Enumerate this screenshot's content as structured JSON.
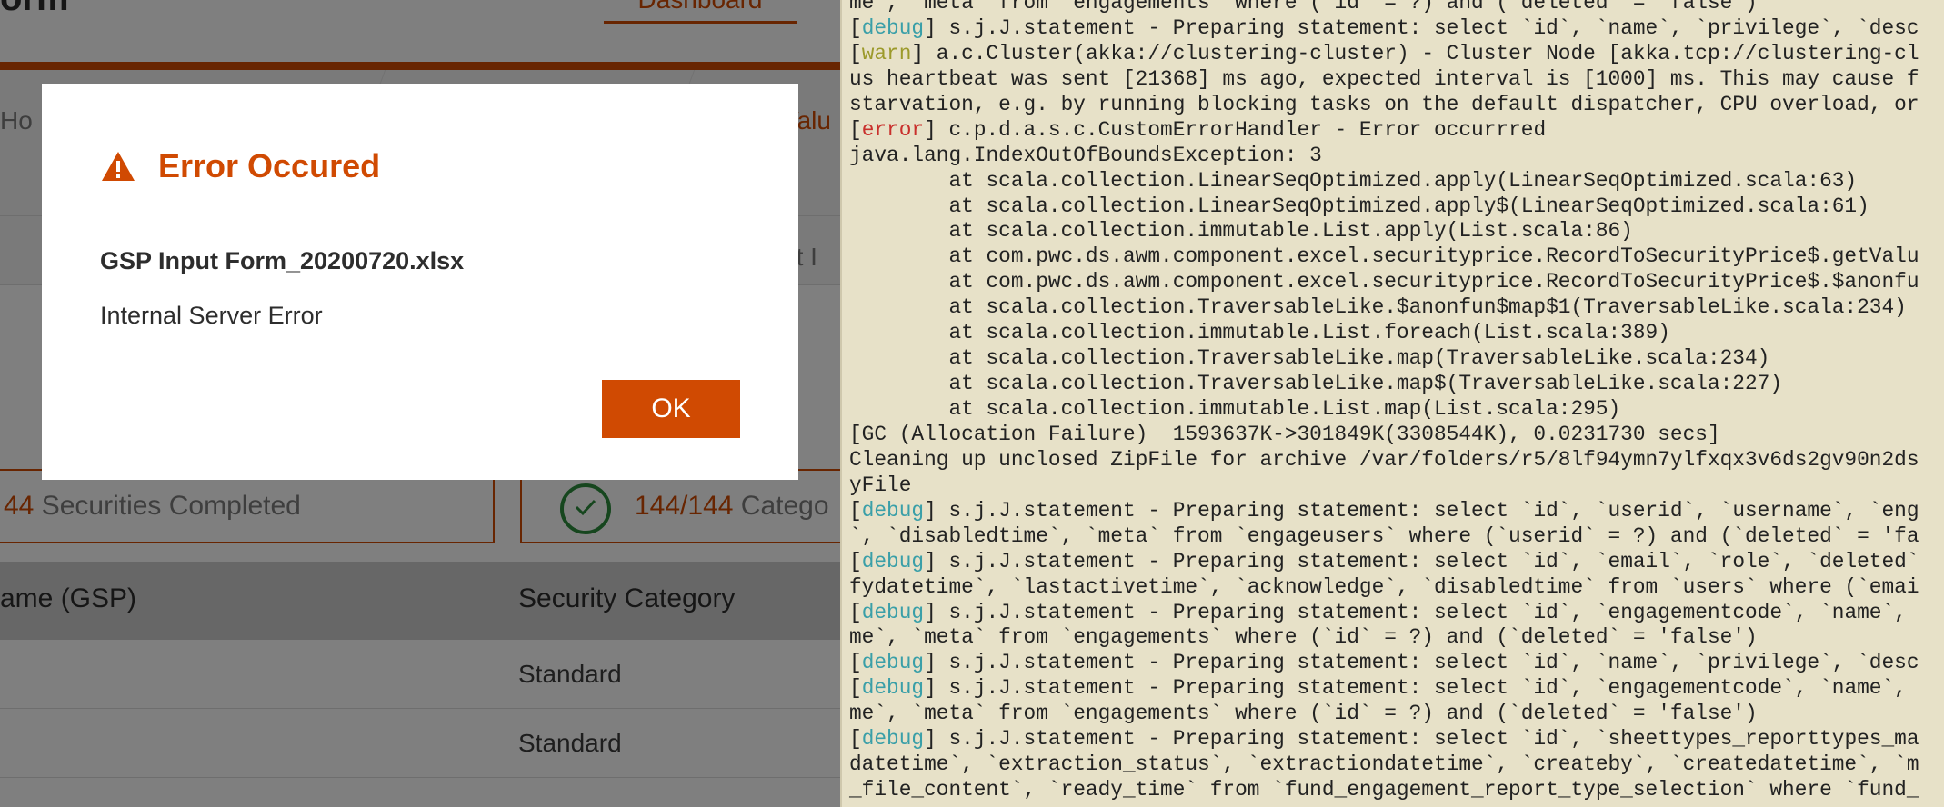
{
  "app": {
    "title": "orm",
    "nav_tab": "Dashboard",
    "steps": [
      "Ho",
      "Valu"
    ],
    "form_label": "ut I",
    "summary": {
      "securities_count": "44",
      "securities_text": " Securities Completed",
      "category_count": "144/144",
      "category_text": " Catego"
    },
    "table": {
      "headers": [
        "ame (GSP)",
        "Security Category"
      ],
      "rows": [
        {
          "category": "Standard"
        },
        {
          "category": "Standard"
        }
      ]
    }
  },
  "modal": {
    "icon": "warning-triangle-icon",
    "title": "Error Occured",
    "file_name": "GSP Input Form_20200720.xlsx",
    "message": "Internal Server Error",
    "ok_label": "OK"
  },
  "colors": {
    "brand": "#d04a02",
    "success": "#2c8c3c",
    "terminal_bg": "#e7e1c8",
    "debug": "#3a9fa8",
    "warn": "#9c9a2b",
    "error": "#c9302c"
  },
  "terminal": {
    "lines": [
      {
        "level": "",
        "text": "me`, `meta` from `engagements` where (`id` = ?) and (`deleted` = 'false')"
      },
      {
        "level": "debug",
        "text": " s.j.J.statement - Preparing statement: select `id`, `name`, `privilege`, `desc"
      },
      {
        "level": "warn",
        "text": " a.c.Cluster(akka://clustering-cluster) - Cluster Node [akka.tcp://clustering-cl"
      },
      {
        "level": "",
        "text": "us heartbeat was sent [21368] ms ago, expected interval is [1000] ms. This may cause f"
      },
      {
        "level": "",
        "text": "starvation, e.g. by running blocking tasks on the default dispatcher, CPU overload, or"
      },
      {
        "level": "error",
        "text": " c.p.d.a.s.c.CustomErrorHandler - Error occurrred"
      },
      {
        "level": "",
        "text": "java.lang.IndexOutOfBoundsException: 3"
      },
      {
        "level": "",
        "text": "        at scala.collection.LinearSeqOptimized.apply(LinearSeqOptimized.scala:63)"
      },
      {
        "level": "",
        "text": "        at scala.collection.LinearSeqOptimized.apply$(LinearSeqOptimized.scala:61)"
      },
      {
        "level": "",
        "text": "        at scala.collection.immutable.List.apply(List.scala:86)"
      },
      {
        "level": "",
        "text": "        at com.pwc.ds.awm.component.excel.securityprice.RecordToSecurityPrice$.getValu"
      },
      {
        "level": "",
        "text": "        at com.pwc.ds.awm.component.excel.securityprice.RecordToSecurityPrice$.$anonfu"
      },
      {
        "level": "",
        "text": "        at scala.collection.TraversableLike.$anonfun$map$1(TraversableLike.scala:234)"
      },
      {
        "level": "",
        "text": "        at scala.collection.immutable.List.foreach(List.scala:389)"
      },
      {
        "level": "",
        "text": "        at scala.collection.TraversableLike.map(TraversableLike.scala:234)"
      },
      {
        "level": "",
        "text": "        at scala.collection.TraversableLike.map$(TraversableLike.scala:227)"
      },
      {
        "level": "",
        "text": "        at scala.collection.immutable.List.map(List.scala:295)"
      },
      {
        "level": "",
        "text": "[GC (Allocation Failure)  1593637K->301849K(3308544K), 0.0231730 secs]"
      },
      {
        "level": "",
        "text": "Cleaning up unclosed ZipFile for archive /var/folders/r5/8lf94ymn7ylfxqx3v6ds2gv90n2ds"
      },
      {
        "level": "",
        "text": "yFile"
      },
      {
        "level": "debug",
        "text": " s.j.J.statement - Preparing statement: select `id`, `userid`, `username`, `eng"
      },
      {
        "level": "",
        "text": "`, `disabledtime`, `meta` from `engageusers` where (`userid` = ?) and (`deleted` = 'fa"
      },
      {
        "level": "debug",
        "text": " s.j.J.statement - Preparing statement: select `id`, `email`, `role`, `deleted`"
      },
      {
        "level": "",
        "text": "fydatetime`, `lastactivetime`, `acknowledge`, `disabledtime` from `users` where (`emai"
      },
      {
        "level": "debug",
        "text": " s.j.J.statement - Preparing statement: select `id`, `engagementcode`, `name`,"
      },
      {
        "level": "",
        "text": "me`, `meta` from `engagements` where (`id` = ?) and (`deleted` = 'false')"
      },
      {
        "level": "debug",
        "text": " s.j.J.statement - Preparing statement: select `id`, `name`, `privilege`, `desc"
      },
      {
        "level": "debug",
        "text": " s.j.J.statement - Preparing statement: select `id`, `engagementcode`, `name`,"
      },
      {
        "level": "",
        "text": "me`, `meta` from `engagements` where (`id` = ?) and (`deleted` = 'false')"
      },
      {
        "level": "debug",
        "text": " s.j.J.statement - Preparing statement: select `id`, `sheettypes_reporttypes_ma"
      },
      {
        "level": "",
        "text": "datetime`, `extraction_status`, `extractiondatetime`, `createby`, `createdatetime`, `m"
      },
      {
        "level": "",
        "text": "_file_content`, `ready_time` from `fund_engagement_report_type_selection` where `fund_"
      }
    ]
  }
}
